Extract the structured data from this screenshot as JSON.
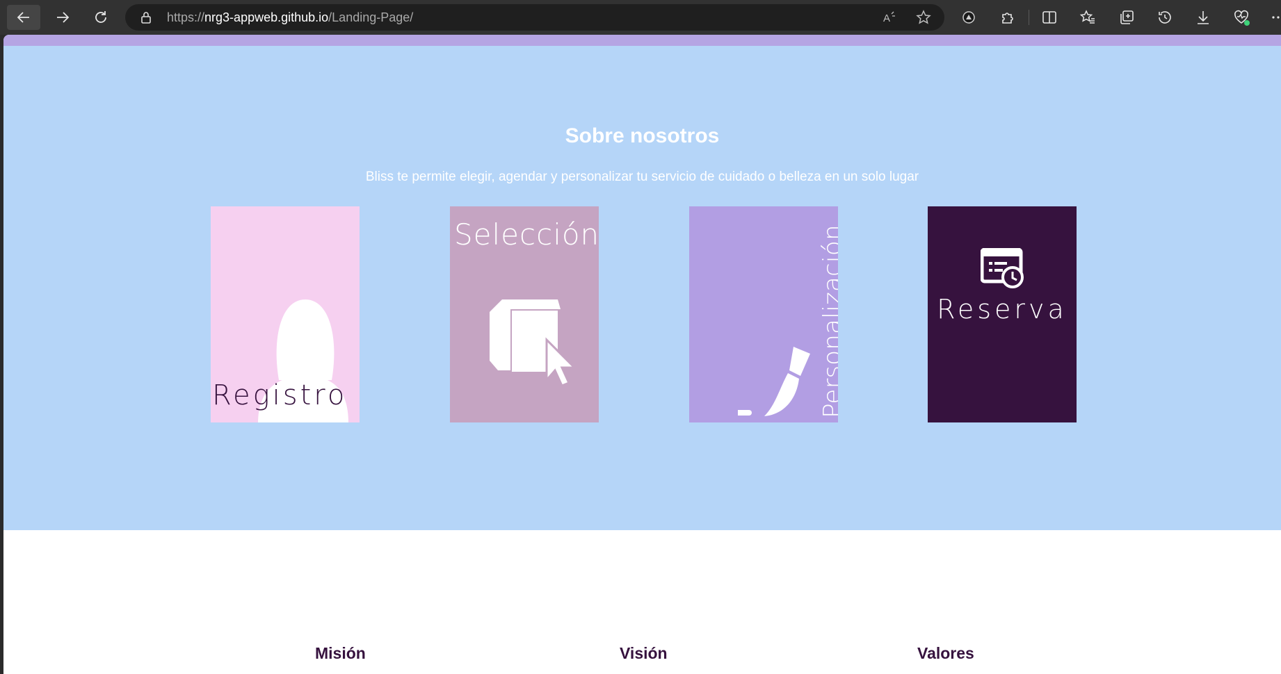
{
  "browser": {
    "url_scheme": "https://",
    "url_host": "nrg3-appweb.github.io",
    "url_path": "/Landing-Page/",
    "icons": [
      "back-icon",
      "forward-icon",
      "refresh-icon",
      "lock-icon",
      "read-aloud-icon",
      "favorite-star-icon",
      "extension-icon",
      "puzzle-icon",
      "split-screen-icon",
      "favorites-icon",
      "collections-icon",
      "history-icon",
      "download-icon",
      "browser-essentials-icon",
      "more-icon"
    ]
  },
  "about": {
    "title": "Sobre nosotros",
    "description": "Bliss te permite elegir, agendar y personalizar tu servicio de cuidado o belleza en un solo lugar"
  },
  "cards": [
    {
      "label": "Registro",
      "icon": "user-silhouette-icon",
      "color": "#f6d0f0"
    },
    {
      "label": "Selección",
      "icon": "box-cursor-icon",
      "color": "#c5a4c2"
    },
    {
      "label": "Personalización",
      "icon": "paintbrush-icon",
      "color": "#b29ee3"
    },
    {
      "label": "Reserva",
      "icon": "calendar-clock-icon",
      "color": "#36123e"
    }
  ],
  "lower": {
    "columns": [
      "Misión",
      "Visión",
      "Valores"
    ]
  },
  "colors": {
    "about_bg": "#b5d5f8",
    "strip": "#b5a4e3",
    "dark_purple": "#36123e"
  }
}
